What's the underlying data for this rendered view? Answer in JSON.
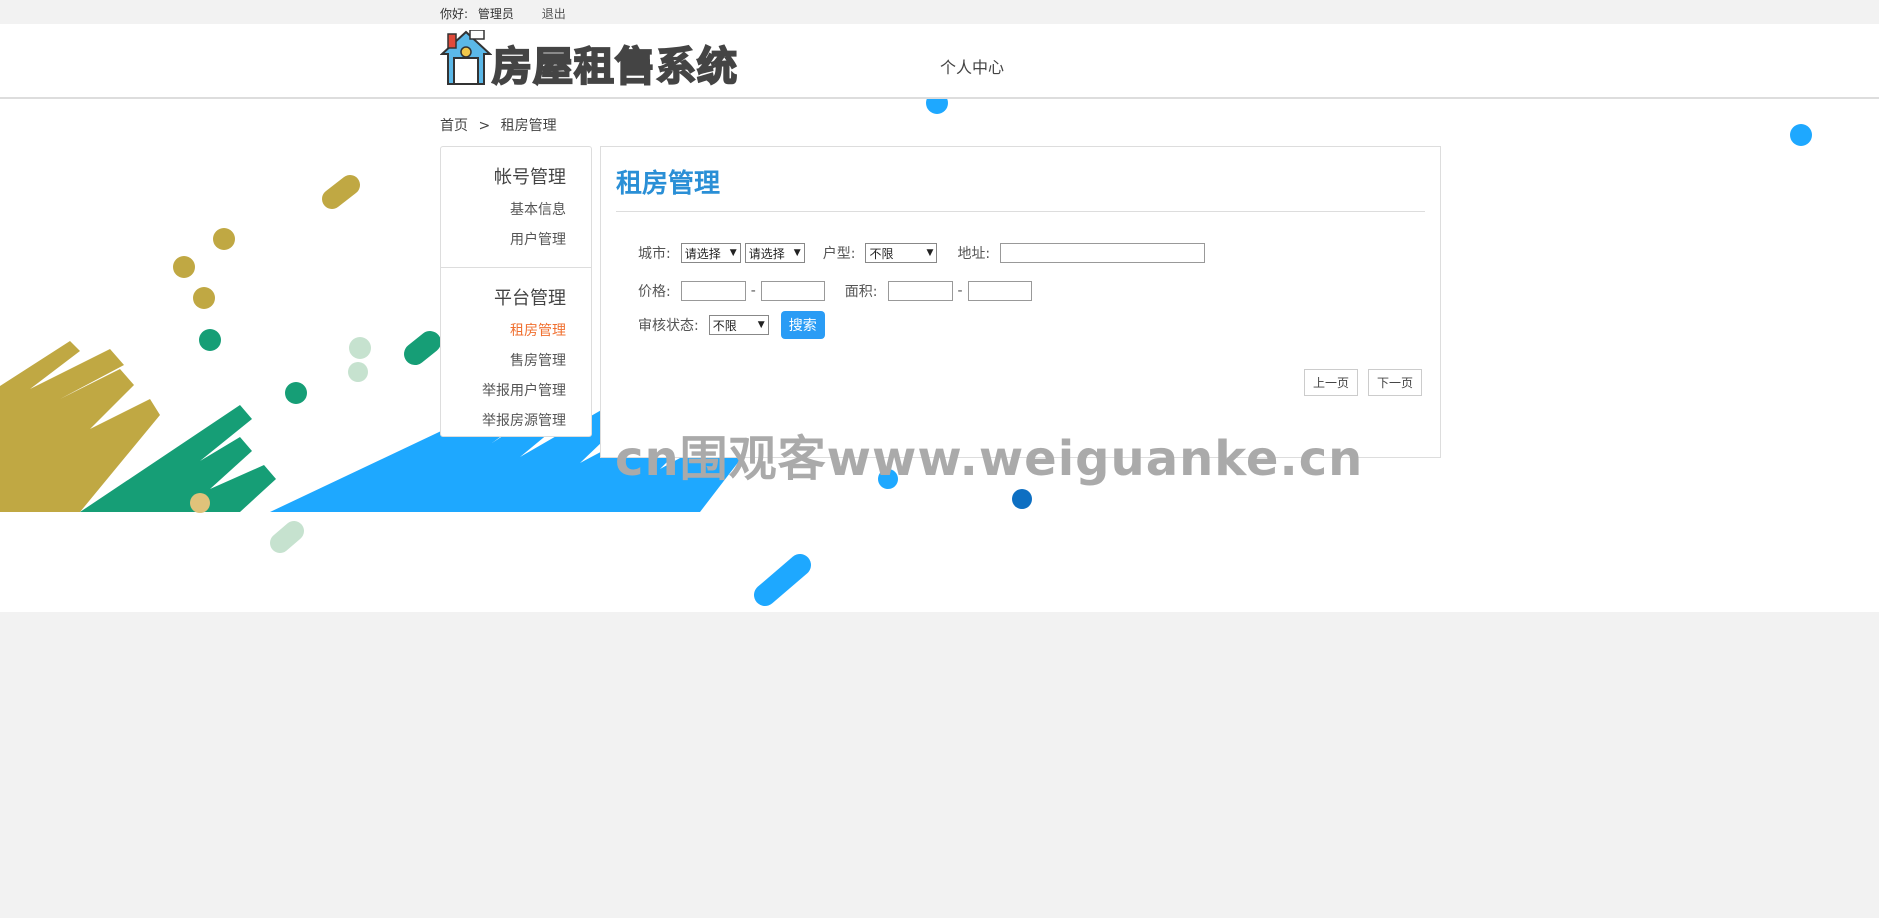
{
  "topbar": {
    "greeting": "你好:",
    "username": "管理员",
    "logout": "退出"
  },
  "header": {
    "logo_text": "房屋租售系统",
    "nav_personal": "个人中心"
  },
  "breadcrumb": {
    "home": "首页",
    "separator": ">",
    "current": "租房管理"
  },
  "sidebar": {
    "group1": {
      "title": "帐号管理",
      "items": [
        {
          "label": "基本信息"
        },
        {
          "label": "用户管理"
        }
      ]
    },
    "group2": {
      "title": "平台管理",
      "items": [
        {
          "label": "租房管理"
        },
        {
          "label": "售房管理"
        },
        {
          "label": "举报用户管理"
        },
        {
          "label": "举报房源管理"
        }
      ]
    }
  },
  "panel": {
    "title": "租房管理",
    "city_label": "城市:",
    "city_select1": "请选择",
    "city_select2": "请选择",
    "type_label": "户型:",
    "type_value": "不限",
    "address_label": "地址:",
    "price_label": "价格:",
    "area_label": "面积:",
    "dash": "-",
    "audit_label": "审核状态:",
    "audit_value": "不限",
    "search_button": "搜索",
    "prev_page": "上一页",
    "next_page": "下一页"
  },
  "watermark": "cn围观客www.weiguanke.cn",
  "colors": {
    "accent": "#2a8fd6",
    "active": "#f07030",
    "button": "#2a9cf5",
    "blue": "#1ea8ff",
    "green": "#169e76",
    "olive": "#c0a843"
  }
}
